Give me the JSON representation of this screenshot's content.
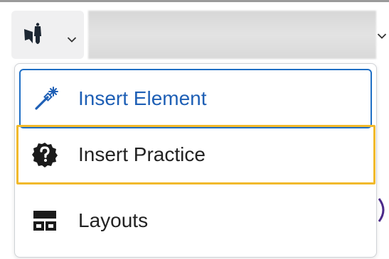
{
  "toolbar": {
    "insert_tool_icon": "insert-stuff-icon",
    "dropdown_icon": "chevron-down-icon"
  },
  "menu": {
    "items": [
      {
        "label": "Insert Element",
        "icon": "magic-wand-icon"
      },
      {
        "label": "Insert Practice",
        "icon": "question-gear-icon"
      },
      {
        "label": "Layouts",
        "icon": "layouts-icon"
      }
    ]
  },
  "colors": {
    "focus_border": "#1f6fc5",
    "highlight_border": "#f1b92b",
    "element_text": "#1e5fb5",
    "text": "#222222"
  }
}
